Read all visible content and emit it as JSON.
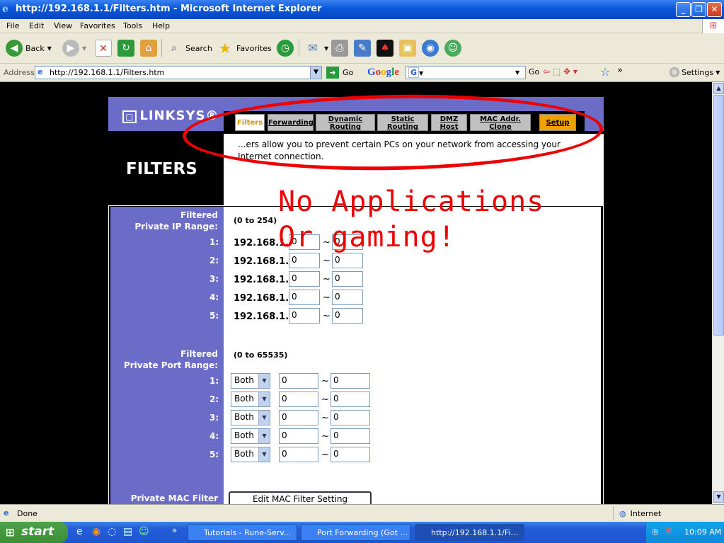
{
  "window": {
    "title": "http://192.168.1.1/Filters.htm - Microsoft Internet Explorer"
  },
  "menu": [
    "File",
    "Edit",
    "View",
    "Favorites",
    "Tools",
    "Help"
  ],
  "toolbar": {
    "back": "Back",
    "search": "Search",
    "favorites": "Favorites"
  },
  "address": {
    "label": "Address",
    "url": "http://192.168.1.1/Filters.htm",
    "go": "Go"
  },
  "google": {
    "logo": "Google",
    "g": "G",
    "go": "Go",
    "settings": "Settings"
  },
  "page": {
    "logo": "LINKSYS",
    "tabs": [
      {
        "label": "Filters"
      },
      {
        "label": "Forwarding"
      },
      {
        "label": "Dynamic\nRouting"
      },
      {
        "label": "Static\nRouting"
      },
      {
        "label": "DMZ\nHost"
      },
      {
        "label": "MAC Addr.\nClone"
      },
      {
        "label": "Setup"
      }
    ],
    "description": "...ers allow you to prevent certain PCs on your network from accessing your Internet connection.",
    "heading": "FILTERS",
    "ip_range": {
      "label_line1": "Filtered",
      "label_line2": "Private IP Range:",
      "hint": "(0 to 254)",
      "prefix": "192.168.1.",
      "rows": [
        {
          "num": "1:",
          "from": "0",
          "to": "0"
        },
        {
          "num": "2:",
          "from": "0",
          "to": "0"
        },
        {
          "num": "3:",
          "from": "0",
          "to": "0"
        },
        {
          "num": "4:",
          "from": "0",
          "to": "0"
        },
        {
          "num": "5:",
          "from": "0",
          "to": "0"
        }
      ]
    },
    "port_range": {
      "label_line1": "Filtered",
      "label_line2": "Private Port Range:",
      "hint": "(0 to 65535)",
      "rows": [
        {
          "num": "1:",
          "proto": "Both",
          "from": "0",
          "to": "0"
        },
        {
          "num": "2:",
          "proto": "Both",
          "from": "0",
          "to": "0"
        },
        {
          "num": "3:",
          "proto": "Both",
          "from": "0",
          "to": "0"
        },
        {
          "num": "4:",
          "proto": "Both",
          "from": "0",
          "to": "0"
        },
        {
          "num": "5:",
          "proto": "Both",
          "from": "0",
          "to": "0"
        }
      ]
    },
    "tilde": "~",
    "mac": {
      "label": "Private MAC Filter",
      "button": "Edit MAC Filter Setting"
    }
  },
  "annotation": {
    "text": "No Applications\nOr gaming!",
    "color": "#e00000"
  },
  "status": {
    "left": "Done",
    "zone": "Internet"
  },
  "taskbar": {
    "start": "start",
    "tasks": [
      "Tutorials - Rune-Serv...",
      "Port Forwarding (Got ...",
      "http://192.168.1.1/Fi..."
    ],
    "clock": "10:09 AM"
  }
}
